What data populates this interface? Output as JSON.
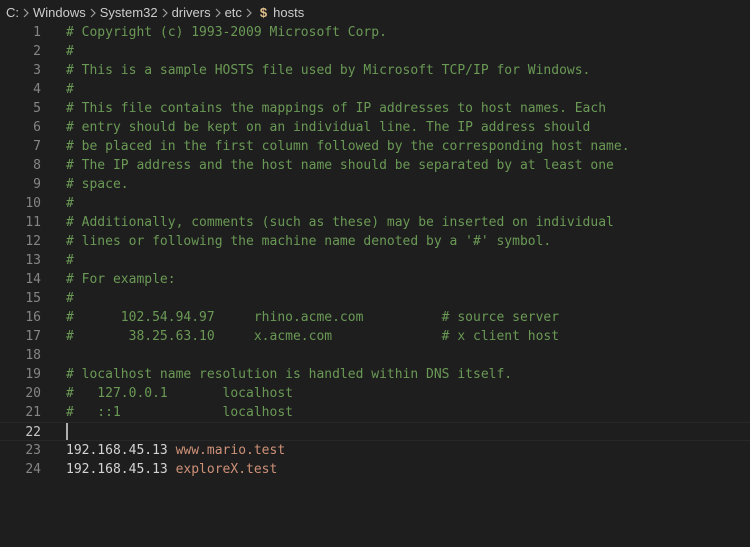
{
  "breadcrumb": {
    "items": [
      "C:",
      "Windows",
      "System32",
      "drivers",
      "etc"
    ],
    "file_icon": "$",
    "file": "hosts"
  },
  "editor": {
    "current_line": 22,
    "lines": [
      {
        "num": "1",
        "type": "comment",
        "text": "# Copyright (c) 1993-2009 Microsoft Corp."
      },
      {
        "num": "2",
        "type": "comment",
        "text": "#"
      },
      {
        "num": "3",
        "type": "comment",
        "text": "# This is a sample HOSTS file used by Microsoft TCP/IP for Windows."
      },
      {
        "num": "4",
        "type": "comment",
        "text": "#"
      },
      {
        "num": "5",
        "type": "comment",
        "text": "# This file contains the mappings of IP addresses to host names. Each"
      },
      {
        "num": "6",
        "type": "comment",
        "text": "# entry should be kept on an individual line. The IP address should"
      },
      {
        "num": "7",
        "type": "comment",
        "text": "# be placed in the first column followed by the corresponding host name."
      },
      {
        "num": "8",
        "type": "comment",
        "text": "# The IP address and the host name should be separated by at least one"
      },
      {
        "num": "9",
        "type": "comment",
        "text": "# space."
      },
      {
        "num": "10",
        "type": "comment",
        "text": "#"
      },
      {
        "num": "11",
        "type": "comment",
        "text": "# Additionally, comments (such as these) may be inserted on individual"
      },
      {
        "num": "12",
        "type": "comment",
        "text": "# lines or following the machine name denoted by a '#' symbol."
      },
      {
        "num": "13",
        "type": "comment",
        "text": "#"
      },
      {
        "num": "14",
        "type": "comment",
        "text": "# For example:"
      },
      {
        "num": "15",
        "type": "comment",
        "text": "#"
      },
      {
        "num": "16",
        "type": "comment",
        "text": "#      102.54.94.97     rhino.acme.com          # source server"
      },
      {
        "num": "17",
        "type": "comment",
        "text": "#       38.25.63.10     x.acme.com              # x client host"
      },
      {
        "num": "18",
        "type": "empty",
        "text": ""
      },
      {
        "num": "19",
        "type": "comment",
        "text": "# localhost name resolution is handled within DNS itself."
      },
      {
        "num": "20",
        "type": "comment",
        "text": "#   127.0.0.1       localhost"
      },
      {
        "num": "21",
        "type": "comment",
        "text": "#   ::1             localhost"
      },
      {
        "num": "22",
        "type": "empty",
        "text": ""
      },
      {
        "num": "23",
        "type": "entry",
        "ip": "192.168.45.13",
        "host": "www.mario.test"
      },
      {
        "num": "24",
        "type": "entry",
        "ip": "192.168.45.13",
        "host": "exploreX.test"
      }
    ]
  },
  "colors": {
    "background": "#1e1e1e",
    "comment": "#6a9955",
    "ip": "#d4d4d4",
    "host": "#ce9178",
    "line_number": "#858585"
  }
}
